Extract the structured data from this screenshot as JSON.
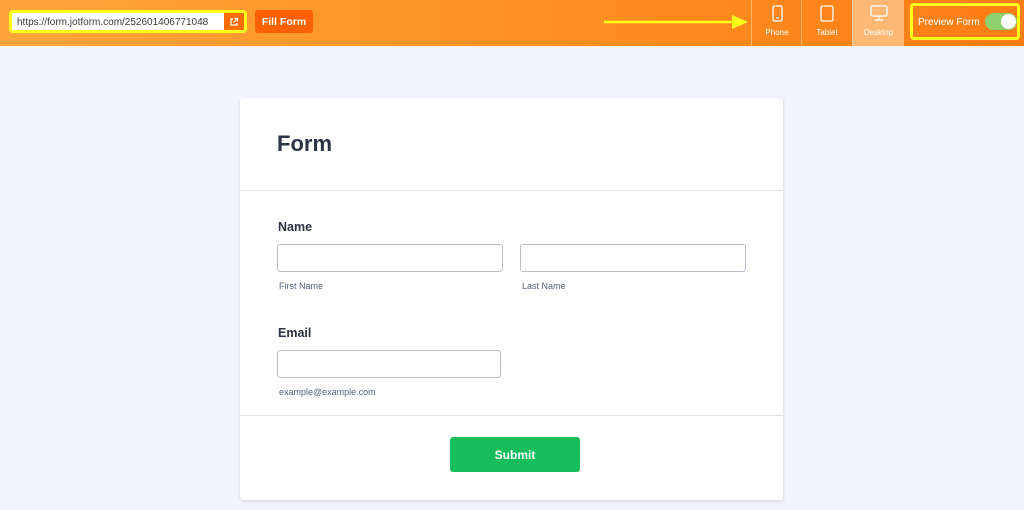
{
  "toolbar": {
    "url": "https://form.jotform.com/252601406771048",
    "open_icon": "external-link-icon",
    "fill_form_label": "Fill Form",
    "devices": [
      {
        "label": "Phone",
        "icon": "phone-icon"
      },
      {
        "label": "Tablet",
        "icon": "tablet-icon"
      },
      {
        "label": "Desktop",
        "icon": "desktop-icon",
        "active": true
      }
    ],
    "preview_label": "Preview Form",
    "preview_enabled": true
  },
  "form": {
    "title": "Form",
    "name_label": "Name",
    "first_name_sublabel": "First Name",
    "last_name_sublabel": "Last Name",
    "email_label": "Email",
    "email_sublabel": "example@example.com",
    "submit_label": "Submit"
  },
  "colors": {
    "accent": "#ff7d14",
    "highlight": "#ffff1a",
    "submit": "#18bd5b",
    "toggle": "#8ed16c"
  }
}
